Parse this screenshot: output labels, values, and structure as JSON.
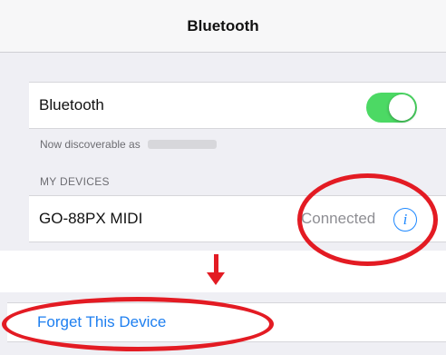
{
  "navbar": {
    "title": "Bluetooth"
  },
  "bluetooth_setting": {
    "label": "Bluetooth",
    "enabled": true
  },
  "discoverable": {
    "text": "Now discoverable as"
  },
  "my_devices": {
    "header": "MY DEVICES",
    "devices": [
      {
        "name": "GO-88PX MIDI",
        "status": "Connected",
        "icon": "info-icon"
      }
    ]
  },
  "device_detail": {
    "forget_label": "Forget This Device"
  },
  "colors": {
    "toggle_on": "#4cd964",
    "accent_blue": "#1e88ff",
    "annotation_red": "#e31b23",
    "background": "#efeff4"
  }
}
